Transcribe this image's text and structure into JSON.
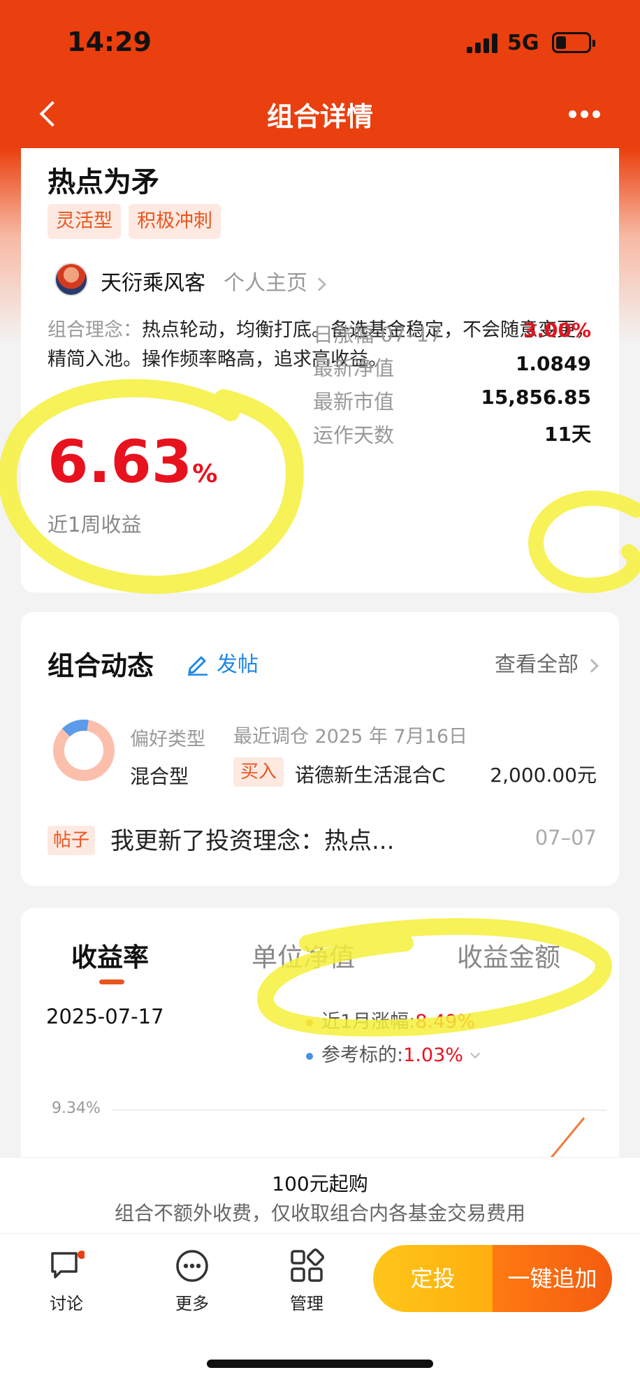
{
  "status_bar": {
    "time": "14:29",
    "network": "5G"
  },
  "nav": {
    "title": "组合详情"
  },
  "fund": {
    "name": "热点为矛",
    "tags": [
      "灵活型",
      "积极冲刺"
    ],
    "owner_name": "天衍乘风客",
    "owner_link": "个人主页",
    "concept_label": "组合理念：",
    "concept_text": "热点轮动，均衡打底。备选基金稳定，不会随意变更，精简入池。操作频率略高，追求高收益。",
    "week_return_value": "6.63",
    "week_return_unit": "%",
    "week_return_label": "近1周收益",
    "stats": [
      {
        "label": "日涨幅 07–17",
        "value": "3.00%",
        "color": "#e8121e"
      },
      {
        "label": "最新净值",
        "value": "1.0849"
      },
      {
        "label": "最新市值",
        "value": "15,856.85"
      },
      {
        "label": "运作天数",
        "value": "11天"
      }
    ]
  },
  "activity": {
    "title": "组合动态",
    "post_button": "发帖",
    "see_all": "查看全部",
    "pref_label": "偏好类型",
    "pref_value": "混合型",
    "pref_share": 0.85,
    "recent_rebalance": "最近调仓 2025 年 7月16日",
    "buy_tag": "买入",
    "buy_fund": "诺德新生活混合C",
    "buy_amount": "2,000.00元",
    "post_tag": "帖子",
    "post_text": "我更新了投资理念：热点...",
    "post_date": "07–07"
  },
  "performance": {
    "tabs": [
      "收益率",
      "单位净值",
      "收益金额"
    ],
    "active_tab": 0,
    "date": "2025-07-17",
    "legend": [
      {
        "label": "近1月涨幅:",
        "value": "8.49%",
        "color": "#f07a3a"
      },
      {
        "label": "参考标的:",
        "value": "1.03%",
        "color": "#4a90e2"
      }
    ],
    "y_tick": "9.34%"
  },
  "bottom": {
    "min_purchase": "100元起购",
    "fee_note": "组合不额外收费，仅收取组合内各基金交易费用"
  },
  "tabbar": {
    "items": [
      "讨论",
      "更多",
      "管理"
    ],
    "dingtou": "定投",
    "add": "一键追加"
  },
  "colors": {
    "brand": "#ea3f0e",
    "up": "#e8121e",
    "highlight": "#f6f03a"
  }
}
